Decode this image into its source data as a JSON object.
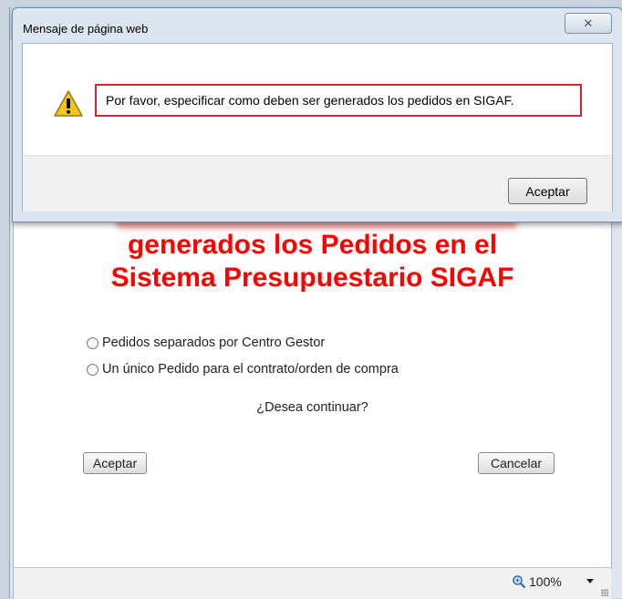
{
  "dialog": {
    "title": "Mensaje de página web",
    "close_glyph": "✕",
    "message": "Por favor, especificar como deben ser generados los pedidos en SIGAF.",
    "ok_label": "Aceptar",
    "icon": "warning-icon"
  },
  "page": {
    "heading_line1": "generados los Pedidos en el",
    "heading_line2": "Sistema Presupuestario SIGAF",
    "options": [
      "Pedidos separados por Centro Gestor",
      "Un único Pedido para el contrato/orden de compra"
    ],
    "question": "¿Desea continuar?",
    "accept_label": "Aceptar",
    "cancel_label": "Cancelar"
  },
  "statusbar": {
    "zoom": "100%",
    "zoom_icon": "magnifier-icon"
  },
  "colors": {
    "heading": "#ff0000",
    "highlight_border": "#d9232e"
  }
}
